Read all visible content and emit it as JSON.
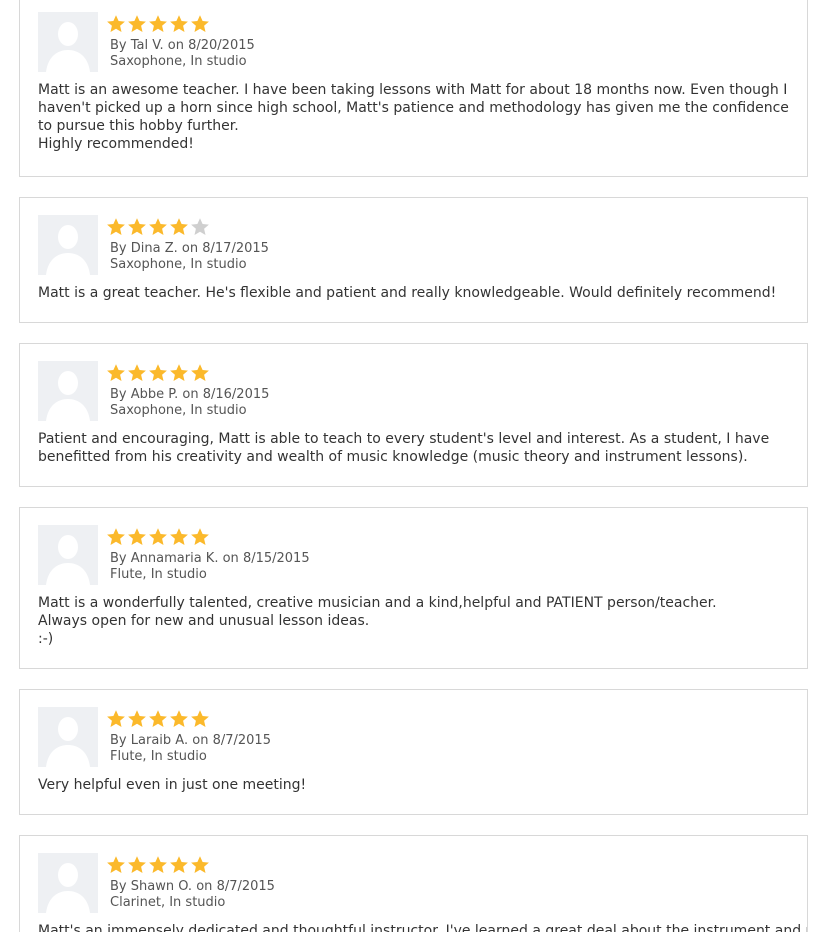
{
  "colors": {
    "star_filled": "#fbb92b",
    "star_empty": "#cfcfcf",
    "border": "#d8d8d8",
    "avatar_bg": "#eef0f3"
  },
  "reviews": [
    {
      "rating": 5,
      "by_prefix": "By",
      "author": "Tal V.",
      "on_word": "on",
      "date": "8/20/2015",
      "instrument_location": "Saxophone, In studio",
      "text_lines": [
        "Matt is an awesome teacher. I have been taking lessons with Matt for about 18 months now. Even though I haven't picked up a horn since high school, Matt's patience and methodology has given me the confidence to pursue this hobby further.",
        "Highly recommended!"
      ]
    },
    {
      "rating": 4,
      "by_prefix": "By",
      "author": "Dina Z.",
      "on_word": "on",
      "date": "8/17/2015",
      "instrument_location": "Saxophone, In studio",
      "text_lines": [
        "Matt is a great teacher. He's flexible and patient and really knowledgeable. Would definitely recommend!"
      ]
    },
    {
      "rating": 5,
      "by_prefix": "By",
      "author": "Abbe P.",
      "on_word": "on",
      "date": "8/16/2015",
      "instrument_location": "Saxophone, In studio",
      "text_lines": [
        "Patient and encouraging, Matt is able to teach to every student's level and interest. As a student, I have benefitted from his creativity and wealth of music knowledge (music theory and instrument lessons)."
      ]
    },
    {
      "rating": 5,
      "by_prefix": "By",
      "author": "Annamaria K.",
      "on_word": "on",
      "date": "8/15/2015",
      "instrument_location": "Flute, In studio",
      "text_lines": [
        "Matt is a wonderfully talented, creative musician and a kind,helpful and PATIENT person/teacher.",
        "Always open for new and unusual lesson ideas.",
        ":-)"
      ]
    },
    {
      "rating": 5,
      "by_prefix": "By",
      "author": "Laraib A.",
      "on_word": "on",
      "date": "8/7/2015",
      "instrument_location": "Flute, In studio",
      "text_lines": [
        "Very helpful even in just one meeting!"
      ]
    },
    {
      "rating": 5,
      "by_prefix": "By",
      "author": "Shawn O.",
      "on_word": "on",
      "date": "8/7/2015",
      "instrument_location": "Clarinet, In studio",
      "text_lines": [
        "Matt's an immensely dedicated and thoughtful instructor. I've learned a great deal about the instrument and my"
      ]
    }
  ]
}
